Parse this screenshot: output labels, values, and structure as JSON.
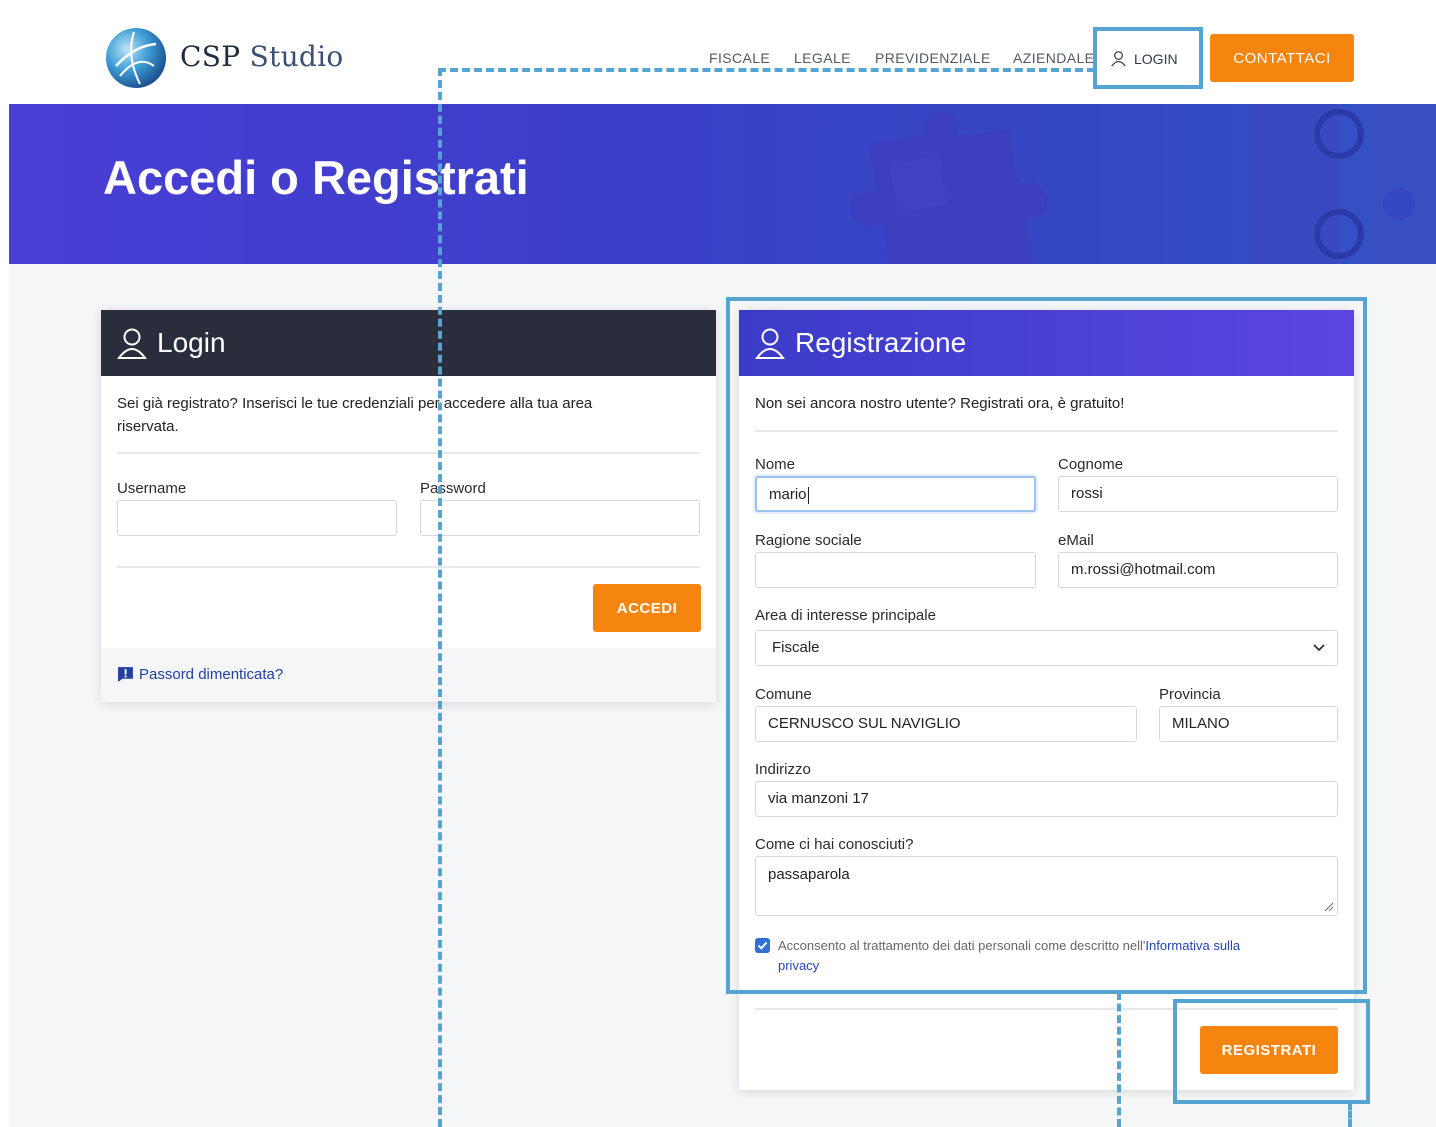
{
  "header": {
    "brand_primary": "CSP",
    "brand_secondary": "Studio",
    "nav": [
      "FISCALE",
      "LEGALE",
      "PREVIDENZIALE",
      "AZIENDALE"
    ],
    "login_label": "LOGIN",
    "contact_label": "CONTATTACI"
  },
  "banner": {
    "title": "Accedi o Registrati"
  },
  "login": {
    "title": "Login",
    "intro_line1": "Sei già registrato? Inserisci le tue credenziali per accedere alla tua area",
    "intro_line2": "riservata.",
    "username_label": "Username",
    "username_value": "",
    "password_label": "Password",
    "password_value": "",
    "submit_label": "ACCEDI",
    "forgot_label": "Passord dimenticata?"
  },
  "register": {
    "title": "Registrazione",
    "intro": "Non sei ancora nostro utente? Registrati ora, è gratuito!",
    "nome_label": "Nome",
    "nome_value": "mario",
    "cognome_label": "Cognome",
    "cognome_value": "rossi",
    "ragione_label": "Ragione sociale",
    "ragione_value": "",
    "email_label": "eMail",
    "email_value": "m.rossi@hotmail.com",
    "area_label": "Area di interesse principale",
    "area_value": "Fiscale",
    "comune_label": "Comune",
    "comune_value": "CERNUSCO SUL NAVIGLIO",
    "provincia_label": "Provincia",
    "provincia_value": "MILANO",
    "indirizzo_label": "Indirizzo",
    "indirizzo_value": "via manzoni 17",
    "source_label": "Come ci hai conosciuti?",
    "source_value": "passaparola",
    "consent_text": "Acconsento al trattamento dei dati personali come descritto nell'",
    "consent_link_1": "Informativa sulla",
    "consent_link_2": "privacy",
    "consent_checked": true,
    "submit_label": "REGISTRATI"
  },
  "colors": {
    "accent_orange": "#f6850f",
    "banner_purple": "#4a3ed6",
    "login_header": "#2a2d3b",
    "link_blue": "#2340a0",
    "annotation_blue": "#55a4d1"
  }
}
